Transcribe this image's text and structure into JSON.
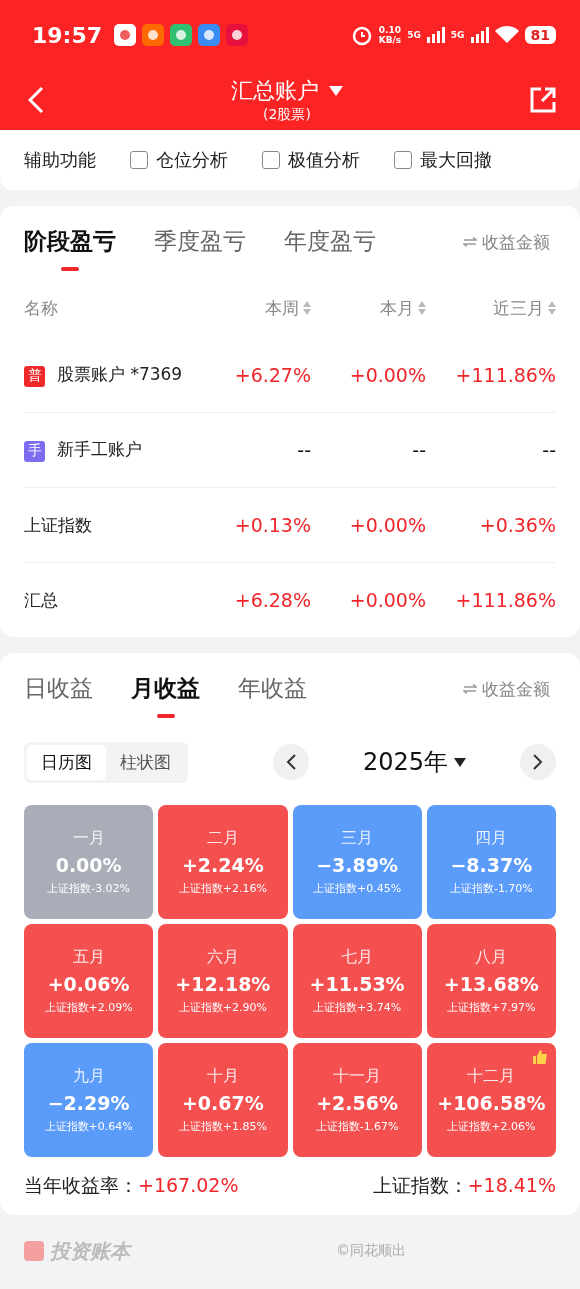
{
  "status_bar": {
    "time": "19:57",
    "speed": "0.10",
    "speed_unit": "KB/s",
    "signals": [
      "5G",
      "5G"
    ],
    "battery": "81"
  },
  "header": {
    "title": "汇总账户",
    "subtitle": "(2股票)"
  },
  "aux": {
    "label": "辅助功能",
    "options": [
      {
        "label": "仓位分析",
        "checked": false
      },
      {
        "label": "极值分析",
        "checked": false
      },
      {
        "label": "最大回撤",
        "checked": false
      }
    ]
  },
  "period_card": {
    "tabs": [
      {
        "label": "阶段盈亏",
        "selected": true
      },
      {
        "label": "季度盈亏",
        "selected": false
      },
      {
        "label": "年度盈亏",
        "selected": false
      }
    ],
    "toggle": "收益金额",
    "columns": [
      "名称",
      "本周",
      "本月",
      "近三月"
    ],
    "rows": [
      {
        "badge": "普",
        "color": "#f02a2a",
        "name": "股票账户 *7369",
        "values": [
          "+6.27%",
          "+0.00%",
          "+111.86%"
        ]
      },
      {
        "badge": "手",
        "color": "#7b6cf0",
        "name": "新手工账户",
        "values": [
          "--",
          "--",
          "--"
        ]
      },
      {
        "name": "上证指数",
        "values": [
          "+0.13%",
          "+0.00%",
          "+0.36%"
        ]
      },
      {
        "name": "汇总",
        "values": [
          "+6.28%",
          "+0.00%",
          "+111.86%"
        ]
      }
    ]
  },
  "income_card": {
    "tabs": [
      {
        "label": "日收益",
        "selected": false
      },
      {
        "label": "月收益",
        "selected": true
      },
      {
        "label": "年收益",
        "selected": false
      }
    ],
    "toggle": "收益金额",
    "views": [
      {
        "label": "日历图",
        "selected": true
      },
      {
        "label": "柱状图",
        "selected": false
      }
    ],
    "year": "2025年",
    "months": [
      {
        "name": "一月",
        "value": "0.00%",
        "index": "上证指数-3.02%",
        "color": "#a9adb8"
      },
      {
        "name": "二月",
        "value": "+2.24%",
        "index": "上证指数+2.16%",
        "color": "#f45050"
      },
      {
        "name": "三月",
        "value": "−3.89%",
        "index": "上证指数+0.45%",
        "color": "#5b9bfa"
      },
      {
        "name": "四月",
        "value": "−8.37%",
        "index": "上证指数-1.70%",
        "color": "#5b9bfa"
      },
      {
        "name": "五月",
        "value": "+0.06%",
        "index": "上证指数+2.09%",
        "color": "#f45050"
      },
      {
        "name": "六月",
        "value": "+12.18%",
        "index": "上证指数+2.90%",
        "color": "#f45050"
      },
      {
        "name": "七月",
        "value": "+11.53%",
        "index": "上证指数+3.74%",
        "color": "#f45050"
      },
      {
        "name": "八月",
        "value": "+13.68%",
        "index": "上证指数+7.97%",
        "color": "#f45050"
      },
      {
        "name": "九月",
        "value": "−2.29%",
        "index": "上证指数+0.64%",
        "color": "#5b9bfa"
      },
      {
        "name": "十月",
        "value": "+0.67%",
        "index": "上证指数+1.85%",
        "color": "#f45050"
      },
      {
        "name": "十一月",
        "value": "+2.56%",
        "index": "上证指数-1.67%",
        "color": "#f45050"
      },
      {
        "name": "十二月",
        "value": "+106.58%",
        "index": "上证指数+2.06%",
        "color": "#f45050",
        "best": true
      }
    ],
    "summary": [
      {
        "label": "当年收益率：",
        "value": "+167.02%"
      },
      {
        "label": "上证指数：",
        "value": "+18.41%"
      }
    ]
  },
  "footer": {
    "brand": "投资账本",
    "copyright": "©同花顺出"
  }
}
